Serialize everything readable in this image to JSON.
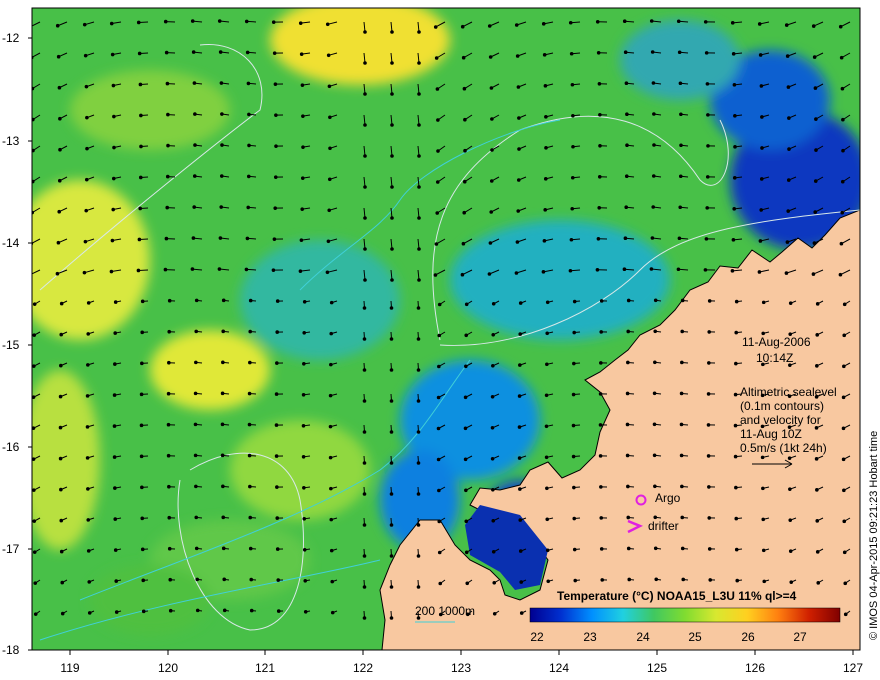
{
  "map": {
    "date": "11-Aug-2006",
    "time": "10:14Z",
    "altimetry_note": [
      "Altimetric sealevel",
      "(0.1m contours)",
      "and velocity for",
      "11-Aug 10Z",
      "0.5m/s (1kt 24h)"
    ],
    "legend_argo": "Argo",
    "legend_drifter": "drifter",
    "isobath_label": "200  1000m",
    "credit": "© IMOS 04-Apr-2015 09:21:23 Hobart time",
    "colorbar": {
      "title": "Temperature (°C) NOAA15_L3U 11% ql>=4",
      "ticks": [
        "22",
        "23",
        "24",
        "25",
        "26",
        "27"
      ],
      "colors": [
        "#000090",
        "#0030d0",
        "#0090ff",
        "#20d0e0",
        "#40c860",
        "#80dc30",
        "#d8e830",
        "#ffd020",
        "#ff8010",
        "#d02000",
        "#800000"
      ]
    },
    "lat_labels": [
      "-12",
      "-13",
      "-14",
      "-15",
      "-16",
      "-17",
      "-18"
    ],
    "lon_labels": [
      "119",
      "120",
      "121",
      "122",
      "123",
      "124",
      "125",
      "126",
      "127"
    ],
    "land_color": "#f8c8a0",
    "marker_color": "#e020e0",
    "contour_color": "#d8e8e8",
    "isobath_color": "#40d0d8"
  }
}
